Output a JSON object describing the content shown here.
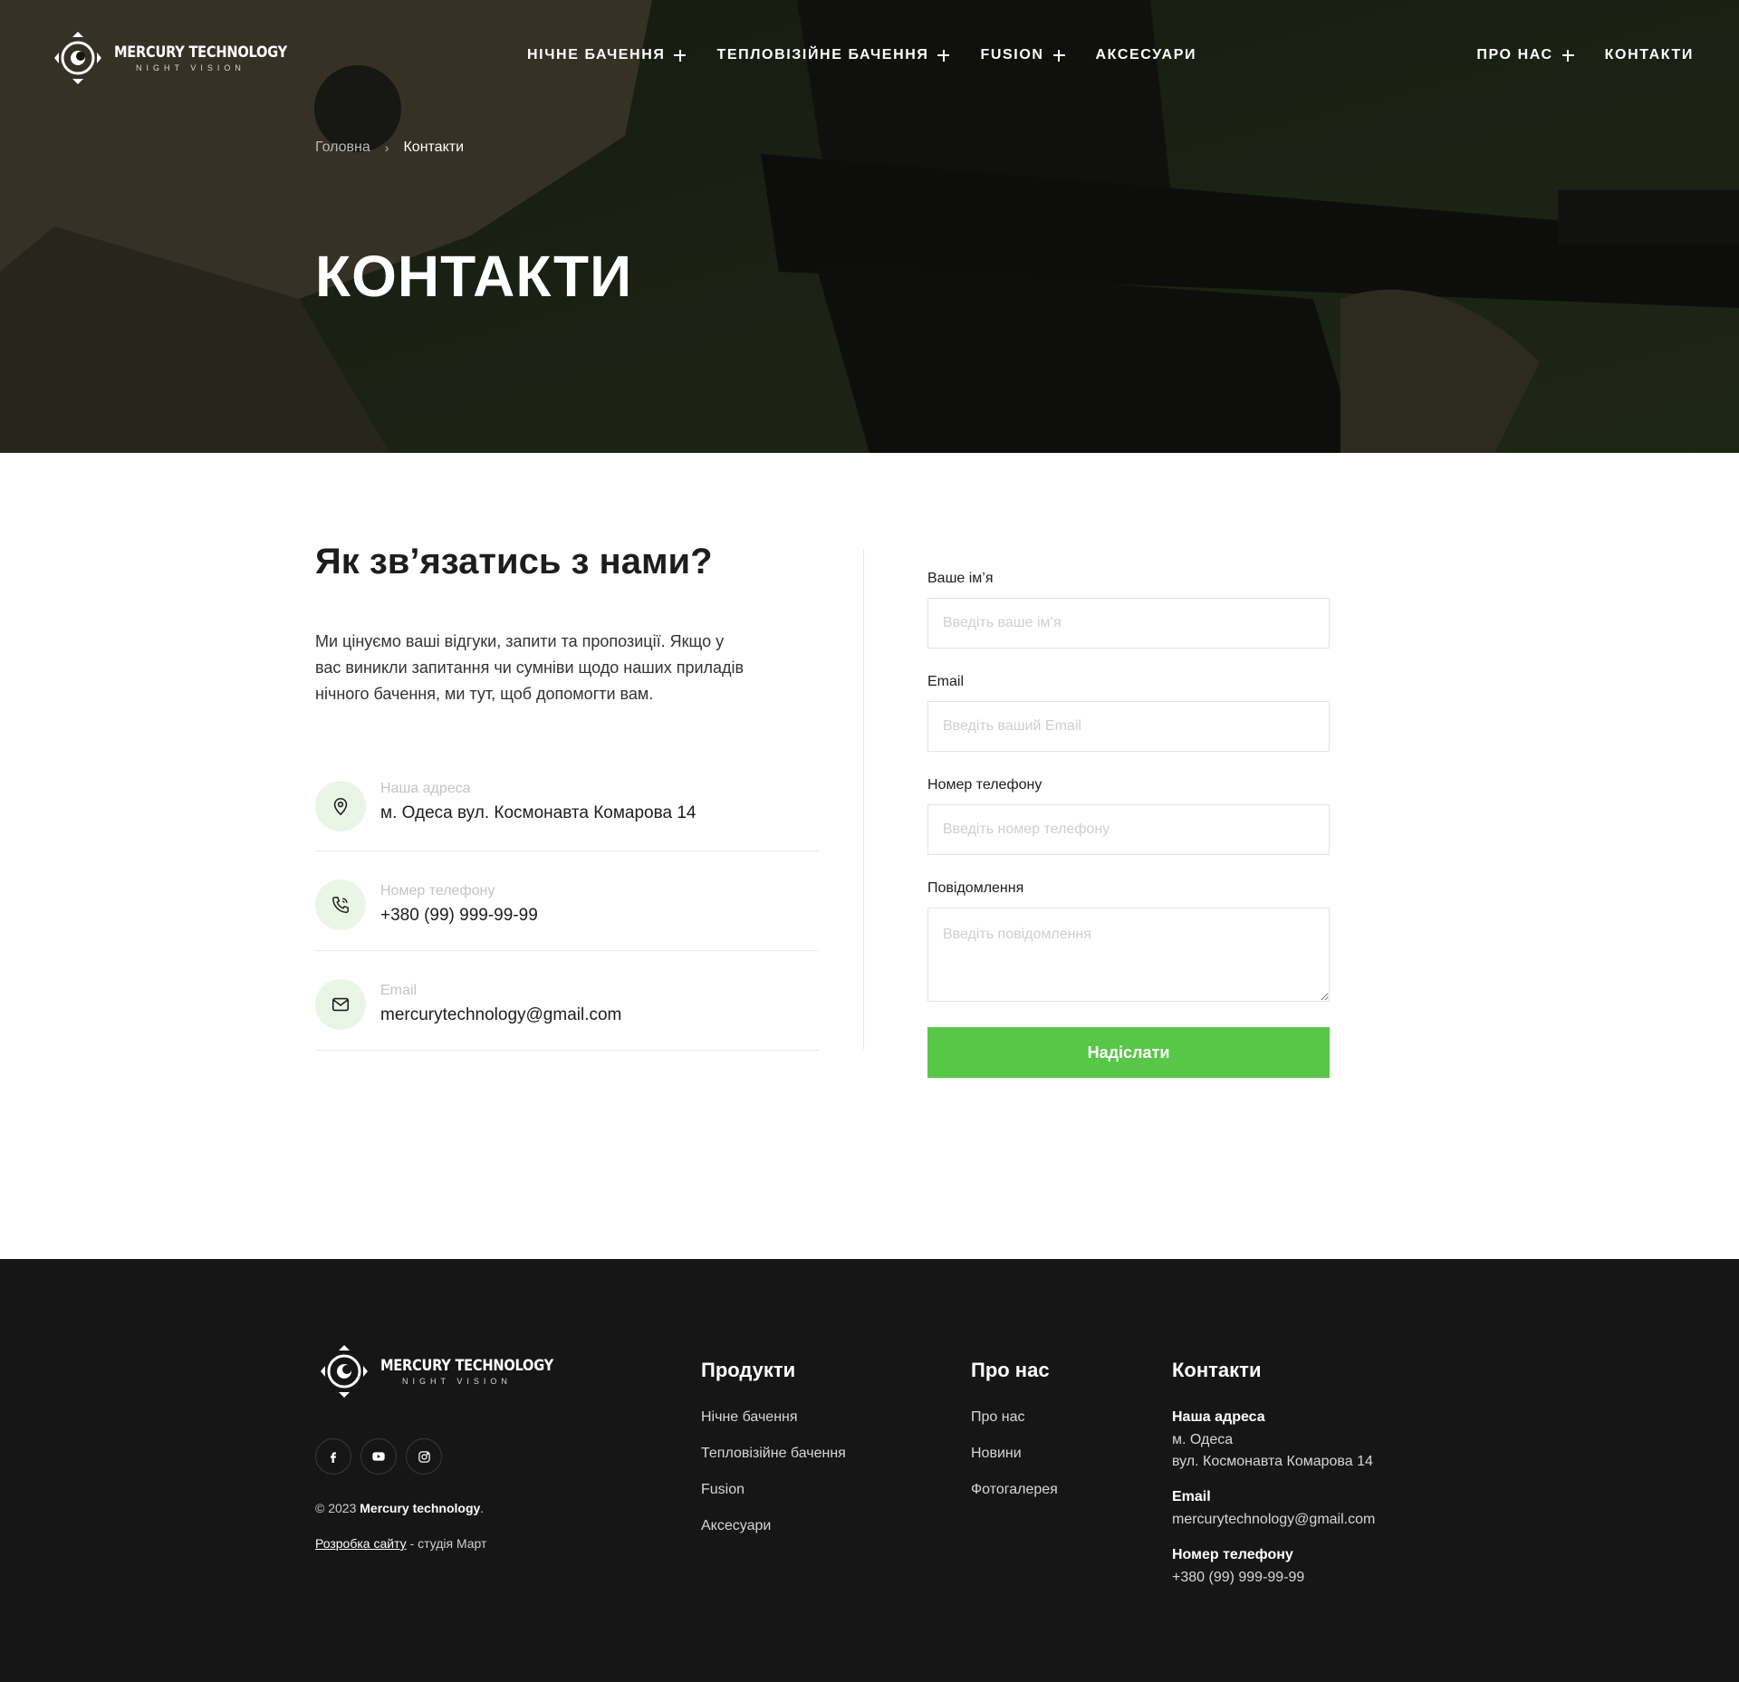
{
  "brand": {
    "name": "MERCURY TECHNOLOGY",
    "tagline": "NIGHT VISION"
  },
  "nav": {
    "left": [
      {
        "label": "НІЧНЕ БАЧЕННЯ",
        "has_submenu": true
      },
      {
        "label": "ТЕПЛОВІЗІЙНЕ БАЧЕННЯ",
        "has_submenu": true
      },
      {
        "label": "FUSION",
        "has_submenu": true
      },
      {
        "label": "АКСЕСУАРИ",
        "has_submenu": false
      }
    ],
    "right": [
      {
        "label": "ПРО НАС",
        "has_submenu": true
      },
      {
        "label": "КОНТАКТИ",
        "has_submenu": false
      }
    ]
  },
  "breadcrumb": {
    "home": "Головна",
    "separator": "›",
    "current": "Контакти"
  },
  "hero": {
    "title": "КОНТАКТИ"
  },
  "contact": {
    "heading": "Як зв’язатись з нами?",
    "intro": "Ми цінуємо ваші відгуки, запити та пропозиції. Якщо у вас виникли запитання чи сумніви щодо наших приладів нічного бачення, ми тут, щоб допомогти вам.",
    "items": [
      {
        "icon": "map-pin-icon",
        "label": "Наша адреса",
        "value": "м. Одеса вул. Космонавта Комарова 14"
      },
      {
        "icon": "phone-icon",
        "label": "Номер телефону",
        "value": "+380 (99) 999-99-99"
      },
      {
        "icon": "mail-icon",
        "label": "Email",
        "value": "mercurytechnology@gmail.com"
      }
    ]
  },
  "form": {
    "name_label": "Ваше ім’я",
    "name_placeholder": "Введіть ваше ім’я",
    "email_label": "Email",
    "email_placeholder": "Введіть ваший Email",
    "phone_label": "Номер телефону",
    "phone_placeholder": "Введіть номер телефону",
    "message_label": "Повідомлення",
    "message_placeholder": "Введіть повідомлення",
    "submit_label": "Надіслати"
  },
  "footer": {
    "social": [
      "facebook-icon",
      "youtube-icon",
      "instagram-icon"
    ],
    "copyright_prefix": "© 2023 ",
    "copyright_name": "Mercury technology",
    "copyright_suffix": ".",
    "credit_link": "Розробка сайту",
    "credit_suffix": " - студія Март",
    "products_title": "Продукти",
    "products": [
      "Нічне бачення",
      "Тепловізійне бачення",
      "Fusion",
      "Аксесуари"
    ],
    "about_title": "Про нас",
    "about": [
      "Про нас",
      "Новини",
      "Фотогалерея"
    ],
    "contacts_title": "Контакти",
    "address_label": "Наша адреса",
    "address_line1": "м. Одеса",
    "address_line2": "вул. Космонавта Комарова 14",
    "email_label": "Email",
    "email_value": "mercurytechnology@gmail.com",
    "phone_label": "Номер телефону",
    "phone_value": "+380 (99) 999-99-99"
  },
  "colors": {
    "accent": "#58c748",
    "accent_soft": "#e9f6e6",
    "footer_bg": "#161616",
    "hero_overlay": "#0c0d09"
  }
}
